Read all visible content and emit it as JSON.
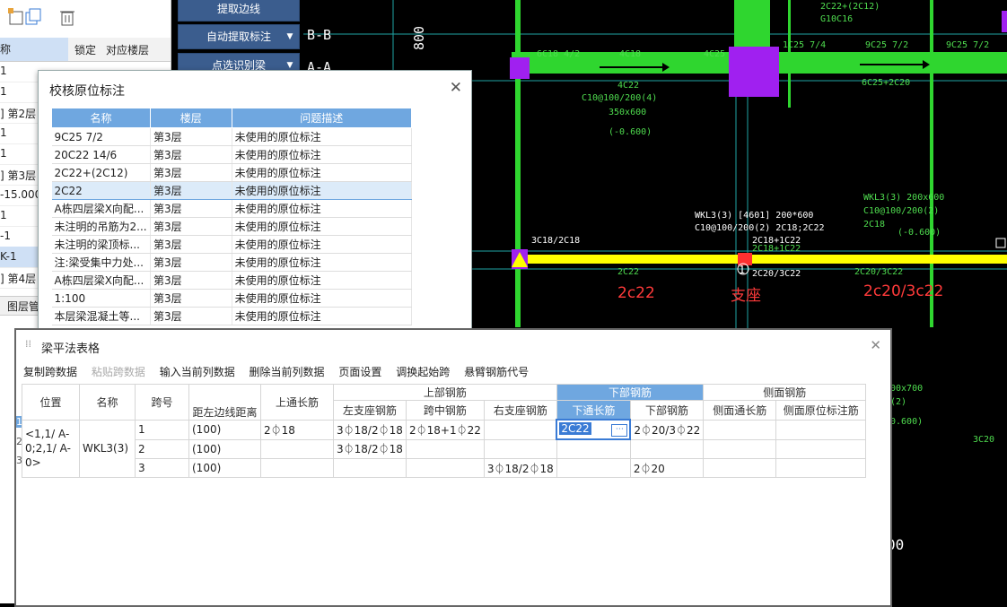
{
  "left_panel": {
    "col_name": "称",
    "col_lock": "锁定",
    "col_floor": "对应楼层",
    "rows": [
      "1",
      "1",
      "] 第2层",
      "1",
      "1",
      "] 第3层",
      "-15.000",
      "1",
      "-1",
      "K-1",
      "] 第4层"
    ],
    "bottom_tab": "图层管"
  },
  "buttons": {
    "extract_edge": "提取边线",
    "auto_extract_label": "自动提取标注",
    "point_select": "点选识别梁"
  },
  "cad": {
    "texts_green": [
      "2C22+(2C12)",
      "G10C16",
      "6C18 4/2",
      "4C18",
      "4C25",
      "1C25 7/4",
      "9C25 7/2",
      "9C25 7/2",
      "6C25+2C20",
      "4C22",
      "C10@100/200(4)",
      "350x600",
      "(-0.600)",
      "WKL3(3) 200x600",
      "C10@100/200(2)",
      "2C18",
      "(-0.600)",
      "3C18/2C18",
      "2C18+1C22",
      "2C20/3C22",
      "2C20/3C22",
      "2C22",
      "3C20",
      "00x700",
      "(2)",
      "0.600)"
    ],
    "texts_white": [
      "B-B",
      "A-A",
      "800",
      "WKL3(3) [4601] 200*600",
      "C10@100/200(2) 2C18;2C22",
      "2C18+1C22",
      "2C20/3C22",
      "1",
      "00"
    ],
    "annotations_red": [
      "2c22",
      "支座",
      "2c20/3c22"
    ]
  },
  "check_dialog": {
    "title": "校核原位标注",
    "headers": [
      "名称",
      "楼层",
      "问题描述"
    ],
    "rows": [
      [
        "9C25 7/2",
        "第3层",
        "未使用的原位标注"
      ],
      [
        "20C22 14/6",
        "第3层",
        "未使用的原位标注"
      ],
      [
        "2C22+(2C12)",
        "第3层",
        "未使用的原位标注"
      ],
      [
        "2C22",
        "第3层",
        "未使用的原位标注"
      ],
      [
        "A栋四层梁X向配...",
        "第3层",
        "未使用的原位标注"
      ],
      [
        "未注明的吊筋为2...",
        "第3层",
        "未使用的原位标注"
      ],
      [
        "未注明的梁顶标...",
        "第3层",
        "未使用的原位标注"
      ],
      [
        "注:梁受集中力处...",
        "第3层",
        "未使用的原位标注"
      ],
      [
        "A栋四层梁X向配...",
        "第3层",
        "未使用的原位标注"
      ],
      [
        "1:100",
        "第3层",
        "未使用的原位标注"
      ],
      [
        "本层梁混凝土等...",
        "第3层",
        "未使用的原位标注"
      ]
    ],
    "selected_row": 3
  },
  "beam_dialog": {
    "title": "梁平法表格",
    "toolbar": [
      "复制跨数据",
      "粘贴跨数据",
      "输入当前列数据",
      "删除当前列数据",
      "页面设置",
      "调换起始跨",
      "悬臂钢筋代号"
    ],
    "group_headers": {
      "top": "上部钢筋",
      "bottom": "下部钢筋",
      "side": "侧面钢筋"
    },
    "headers": {
      "position": "位置",
      "name": "名称",
      "span": "跨号",
      "dist": "距左边线距离",
      "top_through": "上通长筋",
      "left_support": "左支座钢筋",
      "mid_span": "跨中钢筋",
      "right_support": "右支座钢筋",
      "bottom_through": "下通长筋",
      "bottom_bar": "下部钢筋",
      "side_through": "侧面通长筋",
      "side_orig": "侧面原位标注筋"
    },
    "row_numbers": [
      "1",
      "2",
      "3"
    ],
    "position_value": "<1,1/ A-0;2,1/ A-0>",
    "name_value": "WKL3(3)",
    "rows": [
      {
        "span": "1",
        "dist": "(100)",
        "top_through": "2⏀18",
        "left_support": "3⏀18/2⏀18",
        "mid_span": "2⏀18+1⏀22",
        "right_support": "",
        "bottom_through": "2C22",
        "bottom_bar": "2⏀20/3⏀22"
      },
      {
        "span": "2",
        "dist": "(100)",
        "top_through": "",
        "left_support": "3⏀18/2⏀18",
        "mid_span": "",
        "right_support": "",
        "bottom_through": "",
        "bottom_bar": ""
      },
      {
        "span": "3",
        "dist": "(100)",
        "top_through": "",
        "left_support": "",
        "mid_span": "",
        "right_support": "3⏀18/2⏀18",
        "bottom_through": "",
        "bottom_bar": "2⏀20"
      }
    ],
    "edit_button": "⋯"
  }
}
